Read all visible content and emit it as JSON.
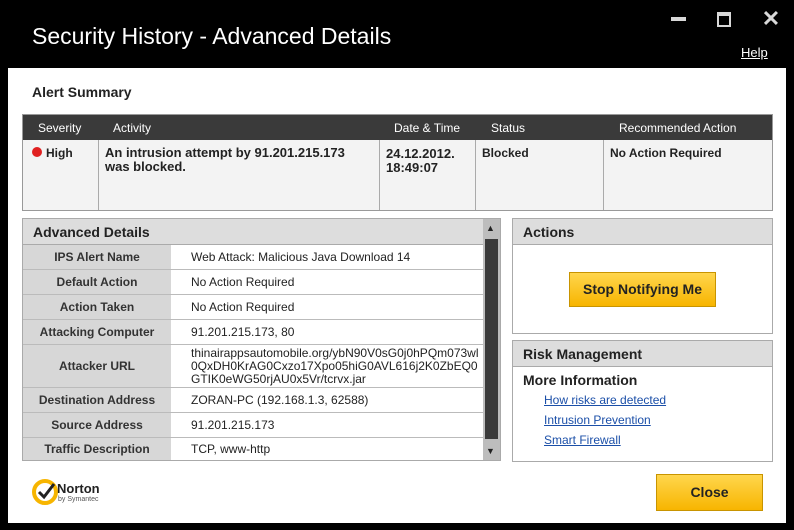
{
  "window": {
    "title": "Security History - Advanced Details",
    "help": "Help",
    "icons": [
      "minimize-icon",
      "maximize-icon",
      "close-icon"
    ]
  },
  "summary": {
    "title": "Alert Summary",
    "columns": [
      "Severity",
      "Activity",
      "Date & Time",
      "Status",
      "Recommended Action"
    ],
    "row": {
      "severity": "High",
      "activity": "An intrusion attempt by 91.201.215.173 was blocked.",
      "datetime_date": "24.12.2012.",
      "datetime_time": "18:49:07",
      "status": "Blocked",
      "recommended": "No Action Required"
    },
    "severity_color": "#e02020"
  },
  "advanced": {
    "title": "Advanced Details",
    "rows": [
      {
        "label": "IPS Alert Name",
        "value": "Web Attack: Malicious Java Download 14"
      },
      {
        "label": "Default Action",
        "value": "No Action Required"
      },
      {
        "label": "Action Taken",
        "value": "No Action Required"
      },
      {
        "label": "Attacking Computer",
        "value": "91.201.215.173, 80"
      },
      {
        "label": "Attacker URL",
        "value1": "thinairappsautomobile.org/ybN90V0sG0j0hPQm073wl",
        "value2": "0QxDH0KrAG0Cxzo17Xpo05hiG0AVL616j2K0ZbEQ0",
        "value3": "GTIK0eWG50rjAU0x5Vr/tcrvx.jar"
      },
      {
        "label": "Destination Address",
        "value": "ZORAN-PC (192.168.1.3, 62588)"
      },
      {
        "label": "Source Address",
        "value": "91.201.215.173"
      },
      {
        "label": "Traffic Description",
        "value": "TCP, www-http"
      }
    ]
  },
  "actions": {
    "title": "Actions",
    "stop_label": "Stop Notifying Me"
  },
  "risk": {
    "title": "Risk Management",
    "more_info": "More Information",
    "links": [
      "How risks are detected",
      "Intrusion Prevention",
      "Smart Firewall"
    ]
  },
  "footer": {
    "close_label": "Close",
    "logo_text": "Norton",
    "logo_sub": "by Symantec"
  },
  "colors": {
    "accent": "#f7b500",
    "header_dark": "#3a3a3a",
    "link": "#1b4fa8"
  }
}
